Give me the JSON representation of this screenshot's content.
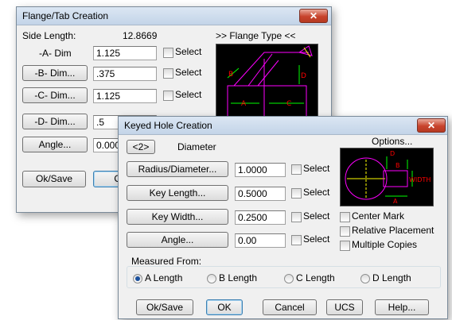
{
  "flange": {
    "title": "Flange/Tab Creation",
    "close": "✕",
    "side_length_label": "Side Length:",
    "side_length_value": "12.8669",
    "flange_type_label": ">> Flange Type <<",
    "a_dim_label": "-A- Dim",
    "a_dim_value": "1.125",
    "b_dim_button": "-B- Dim...",
    "b_dim_value": ".375",
    "c_dim_button": "-C- Dim...",
    "c_dim_value": "1.125",
    "d_dim_button": "-D- Dim...",
    "d_dim_value": ".5",
    "angle_button": "Angle...",
    "angle_value": "0.000",
    "select_label": "Select",
    "ok_save": "Ok/Save",
    "ok": "OK",
    "preview_labels": {
      "a": "A",
      "b": "B",
      "c": "C",
      "d": "D"
    },
    "colors": {
      "preview_bg": "#000000",
      "magenta": "#ff00ff",
      "green": "#00ff00",
      "red": "#ff0000",
      "yellow": "#ffff00"
    }
  },
  "keyed": {
    "title": "Keyed Hole Creation",
    "close": "✕",
    "toggle_button": "<2>",
    "diameter_label": "Diameter",
    "options_label": "Options...",
    "radius_button": "Radius/Diameter...",
    "radius_value": "1.0000",
    "key_length_button": "Key Length...",
    "key_length_value": "0.5000",
    "key_width_button": "Key Width...",
    "key_width_value": "0.2500",
    "angle_button": "Angle...",
    "angle_value": "0.00",
    "select_label": "Select",
    "center_mark": "Center Mark",
    "relative_placement": "Relative Placement",
    "multiple_copies": "Multiple Copies",
    "measured_from": "Measured From:",
    "radios": [
      "A Length",
      "B Length",
      "C Length",
      "D Length"
    ],
    "selected_radio": "A Length",
    "buttons": {
      "ok_save": "Ok/Save",
      "ok": "OK",
      "cancel": "Cancel",
      "ucs": "UCS",
      "help": "Help..."
    },
    "preview_labels": {
      "d": "D",
      "b": "B",
      "width": "WIDTH",
      "a": "A"
    }
  }
}
